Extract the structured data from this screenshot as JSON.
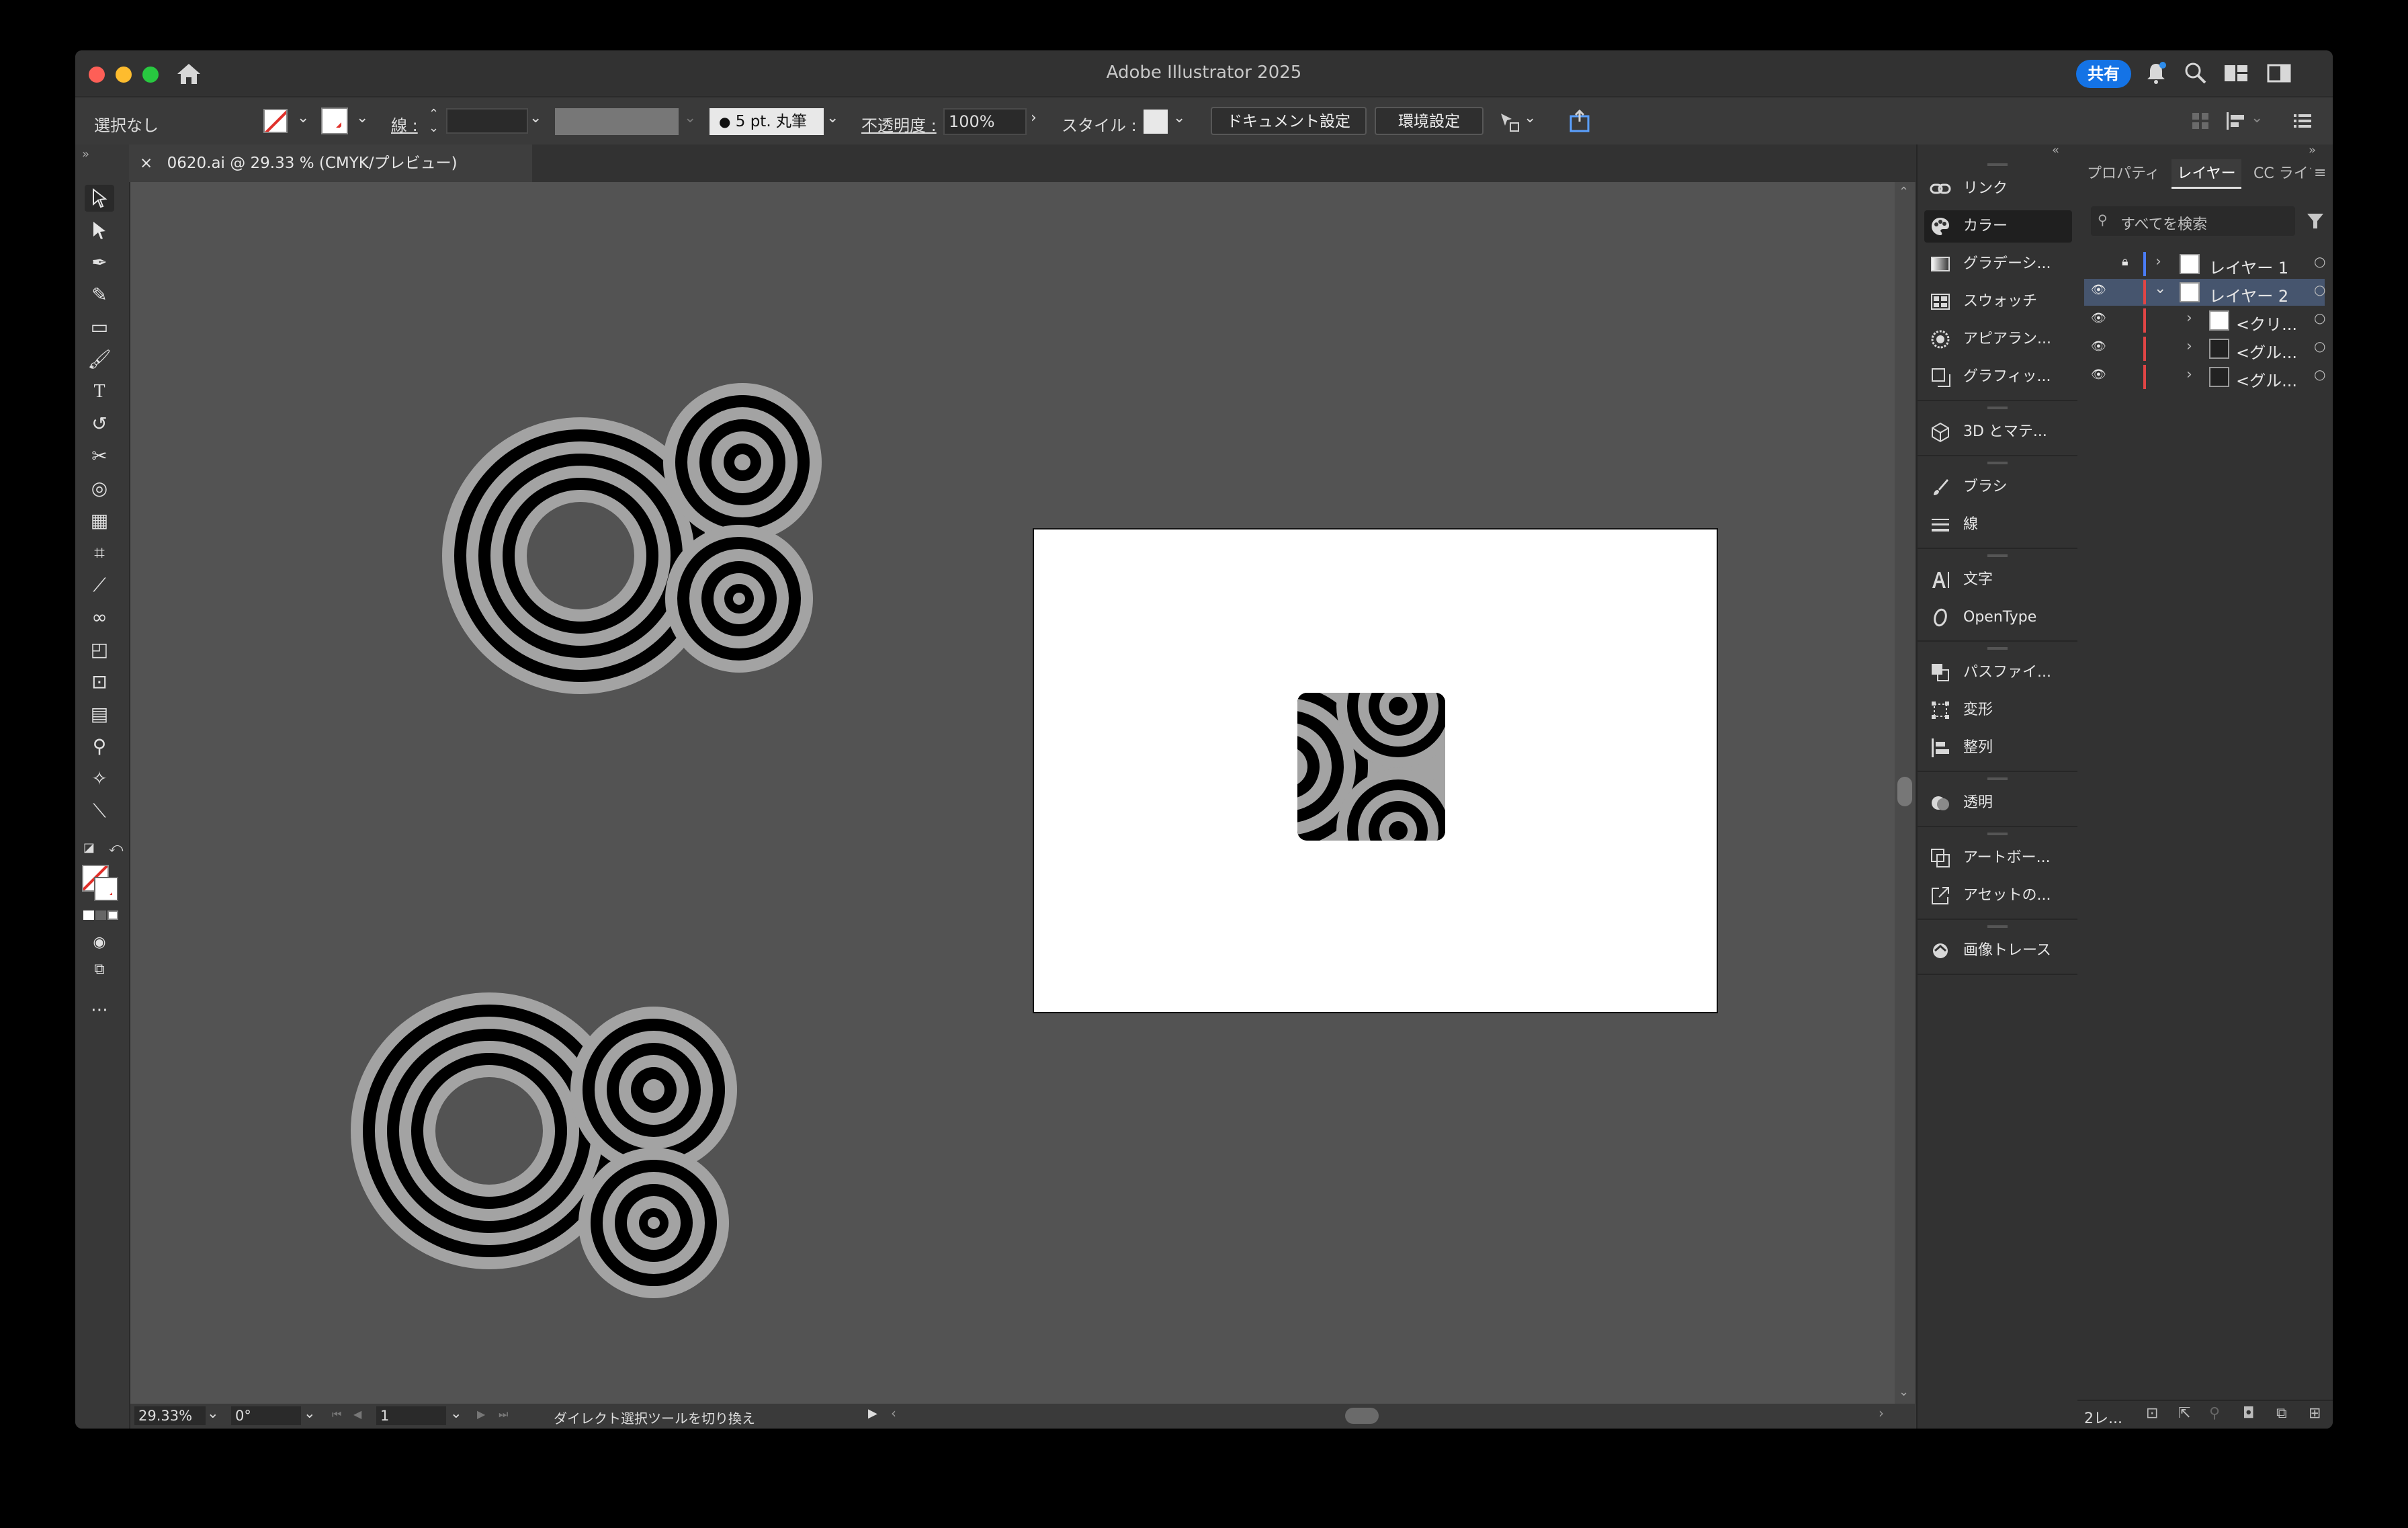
{
  "titlebar": {
    "title": "Adobe Illustrator 2025",
    "share_label": "共有",
    "traffic_colors": [
      "#fe5f57",
      "#febc2e",
      "#28c840"
    ]
  },
  "controlbar": {
    "selection_status": "選択なし",
    "stroke_label": "線 :",
    "brush_label": "5 pt. 丸筆",
    "opacity_label": "不透明度 :",
    "opacity_value": "100%",
    "style_label": "スタイル :",
    "document_setup": "ドキュメント設定",
    "preferences": "環境設定"
  },
  "document_tab": {
    "close": "×",
    "title": "0620.ai @ 29.33 % (CMYK/プレビュー)"
  },
  "statusbar": {
    "zoom": "29.33%",
    "rotation": "0°",
    "artboard_number": "1",
    "tool_info": "ダイレクト選択ツールを切り換え"
  },
  "mid_panel": {
    "items": [
      {
        "label": "リンク",
        "icon": "link-icon"
      },
      {
        "label": "カラー",
        "icon": "color-icon"
      },
      {
        "label": "グラデーシ...",
        "icon": "gradient-icon"
      },
      {
        "label": "スウォッチ",
        "icon": "swatches-icon"
      },
      {
        "label": "アピアラン...",
        "icon": "appearance-icon"
      },
      {
        "label": "グラフィッ...",
        "icon": "graphic-styles-icon"
      },
      {
        "label": "3D とマテ...",
        "icon": "3d-icon"
      },
      {
        "label": "ブラシ",
        "icon": "brush-icon"
      },
      {
        "label": "線",
        "icon": "stroke-icon"
      },
      {
        "label": "文字",
        "icon": "character-icon"
      },
      {
        "label": "OpenType",
        "icon": "opentype-icon"
      },
      {
        "label": "パスファイ...",
        "icon": "pathfinder-icon"
      },
      {
        "label": "変形",
        "icon": "transform-icon"
      },
      {
        "label": "整列",
        "icon": "align-icon"
      },
      {
        "label": "透明",
        "icon": "transparency-icon"
      },
      {
        "label": "アートボー...",
        "icon": "artboards-icon"
      },
      {
        "label": "アセットの...",
        "icon": "asset-export-icon"
      },
      {
        "label": "画像トレース",
        "icon": "image-trace-icon"
      }
    ]
  },
  "layers_panel": {
    "tabs": [
      "プロパティ",
      "レイヤー",
      "CC ライブラリ"
    ],
    "search_placeholder": "すべてを検索",
    "layers": [
      {
        "name": "レイヤー 1",
        "visible": false,
        "locked": true,
        "color": "#4a7cf7"
      },
      {
        "name": "レイヤー 2",
        "visible": true,
        "locked": false,
        "color": "#e04545",
        "expanded": true,
        "selected": true
      },
      {
        "name": "<クリ...",
        "visible": true,
        "color": "#e04545"
      },
      {
        "name": "<グル...",
        "visible": true,
        "color": "#e04545"
      },
      {
        "name": "<グル...",
        "visible": true,
        "color": "#e04545"
      }
    ],
    "footer_count": "2レ..."
  },
  "colors": {
    "accent": "#1473e6",
    "selected_row": "#46556e",
    "canvas": "#535353"
  }
}
